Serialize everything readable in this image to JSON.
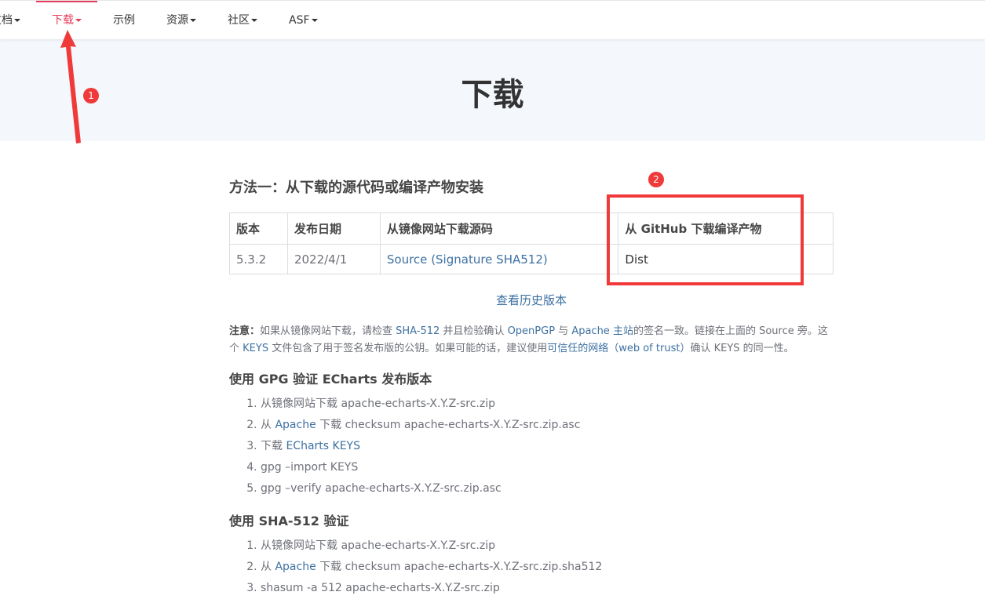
{
  "nav": {
    "items": [
      {
        "label": "文档",
        "caret": true
      },
      {
        "label": "下载",
        "caret": true,
        "active": true
      },
      {
        "label": "示例",
        "caret": false
      },
      {
        "label": "资源",
        "caret": true
      },
      {
        "label": "社区",
        "caret": true
      },
      {
        "label": "ASF",
        "caret": true
      }
    ]
  },
  "hero": {
    "title": "下载"
  },
  "method1": {
    "title": "方法一：从下载的源代码或编译产物安装",
    "table": {
      "headers": [
        "版本",
        "发布日期",
        "从镜像网站下载源码",
        "从 GitHub 下载编译产物"
      ],
      "row": {
        "version": "5.3.2",
        "date": "2022/4/1",
        "source": "Source",
        "signature": "(Signature SHA512)",
        "dist": "Dist"
      }
    },
    "history_link": "查看历史版本"
  },
  "note": {
    "label": "注意：",
    "t1": "如果从镜像网站下载，请检查 ",
    "l1": "SHA-512",
    "t2": " 并且检验确认 ",
    "l2": "OpenPGP",
    "t3": " 与 ",
    "l3": "Apache 主站",
    "t4": "的签名一致。链接在上面的 Source 旁。这个 ",
    "l4": "KEYS",
    "t5": " 文件包含了用于签名发布版的公钥。如果可能的话，建议使用",
    "l5": "可信任的网络（web of trust）",
    "t6": "确认 KEYS 的同一性。"
  },
  "gpg": {
    "title": "使用 GPG 验证 ECharts 发布版本",
    "step1": "从镜像网站下载 apache-echarts-X.Y.Z-src.zip",
    "step2_pre": "从 ",
    "step2_link": "Apache",
    "step2_post": " 下载 checksum apache-echarts-X.Y.Z-src.zip.asc",
    "step3_pre": "下载 ",
    "step3_link": "ECharts KEYS",
    "step4": "gpg –import KEYS",
    "step5": "gpg –verify apache-echarts-X.Y.Z-src.zip.asc"
  },
  "sha": {
    "title": "使用 SHA-512 验证",
    "step1": "从镜像网站下载 apache-echarts-X.Y.Z-src.zip",
    "step2_pre": "从 ",
    "step2_link": "Apache",
    "step2_post": " 下载 checksum apache-echarts-X.Y.Z-src.zip.sha512",
    "step3": "shasum -a 512 apache-echarts-X.Y.Z-src.zip"
  },
  "annotations": {
    "badge1": "1",
    "badge2": "2",
    "color": "#f03a3a"
  },
  "colors": {
    "accent": "#e43c59",
    "link": "#3d71a2",
    "hero_bg": "#f4f7fb"
  }
}
